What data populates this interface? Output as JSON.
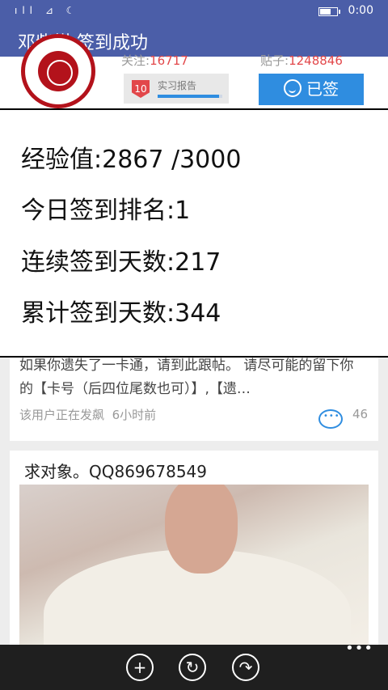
{
  "status_bar": {
    "time": "0:00",
    "icons": "ıll ⊿ ☾"
  },
  "title_bar": {
    "title": "邓紫棋 签到成功"
  },
  "header": {
    "follow_label": "关注:",
    "follow_value": "16717",
    "posts_label": "贴子:",
    "posts_value": "1248846",
    "level_badge": "10",
    "report_label": "实习报告",
    "report_progress": 0.95,
    "signed_button_label": "已签"
  },
  "popup": {
    "lines": [
      "经验值:2867 /3000",
      "今日签到排名:1",
      "连续签到天数:217",
      "累计签到天数:344"
    ]
  },
  "feed": {
    "post1": {
      "body": "如果你遗失了一卡通，请到此跟帖。 请尽可能的留下你的【卡号（后四位尾数也可）】,【遗…",
      "author_status": "该用户正在发飙",
      "time": "6小时前",
      "comments": "46"
    },
    "post2": {
      "title": "求对象。QQ869678549"
    }
  },
  "bottom_bar": {
    "add": "+",
    "refresh": "↻",
    "share": "↷",
    "more": "•••"
  },
  "colors": {
    "accent": "#4b5ea8",
    "button": "#2f8de0",
    "highlight": "#e2474a"
  }
}
